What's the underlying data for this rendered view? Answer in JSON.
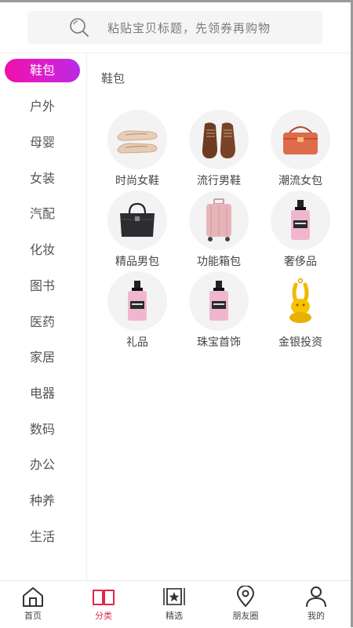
{
  "search": {
    "placeholder": "粘贴宝贝标题，先领券再购物"
  },
  "sidebar": {
    "items": [
      {
        "label": "鞋包",
        "active": true
      },
      {
        "label": "户外"
      },
      {
        "label": "母婴"
      },
      {
        "label": "女装"
      },
      {
        "label": "汽配"
      },
      {
        "label": "化妆"
      },
      {
        "label": "图书"
      },
      {
        "label": "医药"
      },
      {
        "label": "家居"
      },
      {
        "label": "电器"
      },
      {
        "label": "数码"
      },
      {
        "label": "办公"
      },
      {
        "label": "种养"
      },
      {
        "label": "生活"
      }
    ]
  },
  "content": {
    "title": "鞋包",
    "items": [
      {
        "label": "时尚女鞋",
        "icon": "women-flats-icon"
      },
      {
        "label": "流行男鞋",
        "icon": "men-shoes-icon"
      },
      {
        "label": "潮流女包",
        "icon": "handbag-icon"
      },
      {
        "label": "精品男包",
        "icon": "briefcase-icon"
      },
      {
        "label": "功能箱包",
        "icon": "suitcase-icon"
      },
      {
        "label": "奢侈品",
        "icon": "perfume-bottle-icon"
      },
      {
        "label": "礼品",
        "icon": "perfume-bottle-icon"
      },
      {
        "label": "珠宝首饰",
        "icon": "perfume-bottle-icon"
      },
      {
        "label": "金银投资",
        "icon": "gold-rabbit-icon"
      }
    ]
  },
  "tabbar": {
    "items": [
      {
        "label": "首页",
        "icon": "home-icon"
      },
      {
        "label": "分类",
        "icon": "book-icon",
        "active": true
      },
      {
        "label": "精选",
        "icon": "star-frame-icon"
      },
      {
        "label": "朋友圈",
        "icon": "location-pin-icon"
      },
      {
        "label": "我的",
        "icon": "user-icon"
      }
    ]
  },
  "colors": {
    "accent": "#e0264c",
    "pill_start": "#f010a8",
    "pill_end": "#b62be6"
  }
}
